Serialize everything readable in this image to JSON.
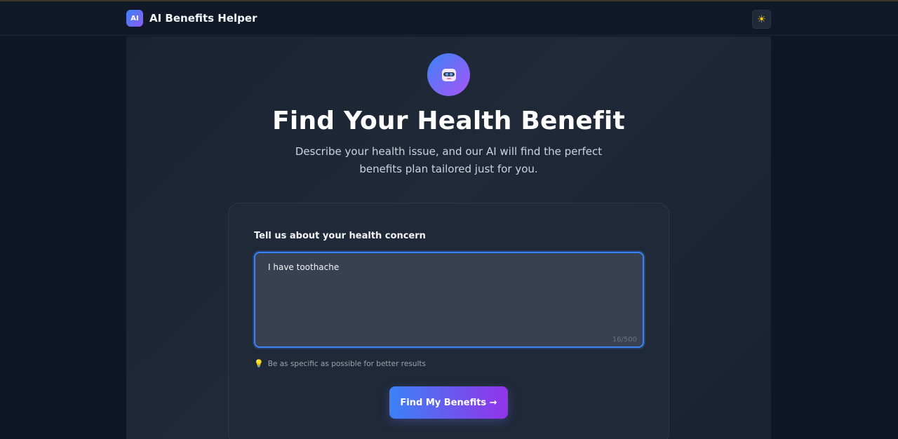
{
  "header": {
    "logo_text": "AI",
    "app_name": "AI Benefits Helper",
    "theme_toggle_icon": "☀"
  },
  "hero": {
    "avatar_icon": "robot-icon",
    "title": "Find Your Health Benefit",
    "subtitle": "Describe your health issue, and our AI will find the perfect benefits plan tailored just for you."
  },
  "form": {
    "label": "Tell us about your health concern",
    "input_value": "I have toothache",
    "char_count": "16/500",
    "hint_icon": "💡",
    "hint_text": "Be as specific as possible for better results",
    "submit_label": "Find My Benefits →"
  },
  "colors": {
    "accent_start": "#3b82f6",
    "accent_end": "#9333ea",
    "background": "#0f1626",
    "card": "#1f2937"
  }
}
